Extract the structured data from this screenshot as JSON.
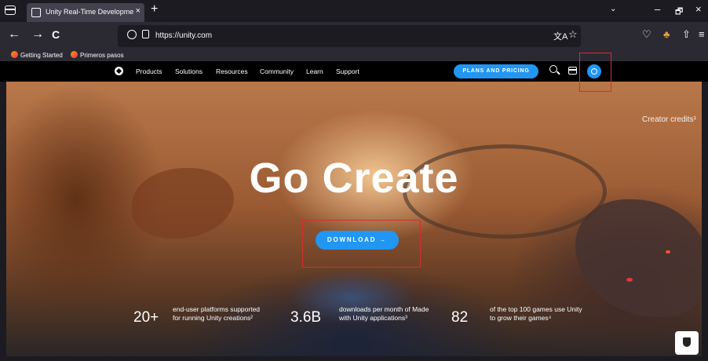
{
  "browser": {
    "tab_title": "Unity Real-Time Development Platf",
    "tab_close": "×",
    "new_tab": "+",
    "tabs_dropdown": "⌄",
    "window_controls": {
      "minimize": "–",
      "maximize": "🗗",
      "close": "×"
    },
    "nav": {
      "back": "←",
      "forward": "→",
      "reload": "C"
    },
    "url": "https://unity.com",
    "url_icons": {
      "translate": "文A",
      "bookmark_star": "☆"
    },
    "toolbar_icons": {
      "pocket": "♡",
      "extension": "♣",
      "share": "⇧",
      "menu": "≡"
    },
    "bookmarks": [
      {
        "label": "Getting Started"
      },
      {
        "label": "Primeros pasos"
      }
    ]
  },
  "site": {
    "nav_links": [
      "Products",
      "Solutions",
      "Resources",
      "Community",
      "Learn",
      "Support"
    ],
    "plans_button": "PLANS AND PRICING",
    "accent_color": "#2196f3",
    "hero": {
      "creator_credits": "Creator credits¹",
      "headline": "Go Create",
      "download_button": "DOWNLOAD →",
      "stats": [
        {
          "number": "20+",
          "description": "end-user platforms supported for running Unity creations²"
        },
        {
          "number": "3.6B",
          "description": "downloads per month of Made with Unity applications³"
        },
        {
          "number": "82",
          "description": "of the top 100 games use Unity to grow their games⁴"
        }
      ]
    }
  },
  "annotations": {
    "highlight_color": "#d32f2f"
  }
}
